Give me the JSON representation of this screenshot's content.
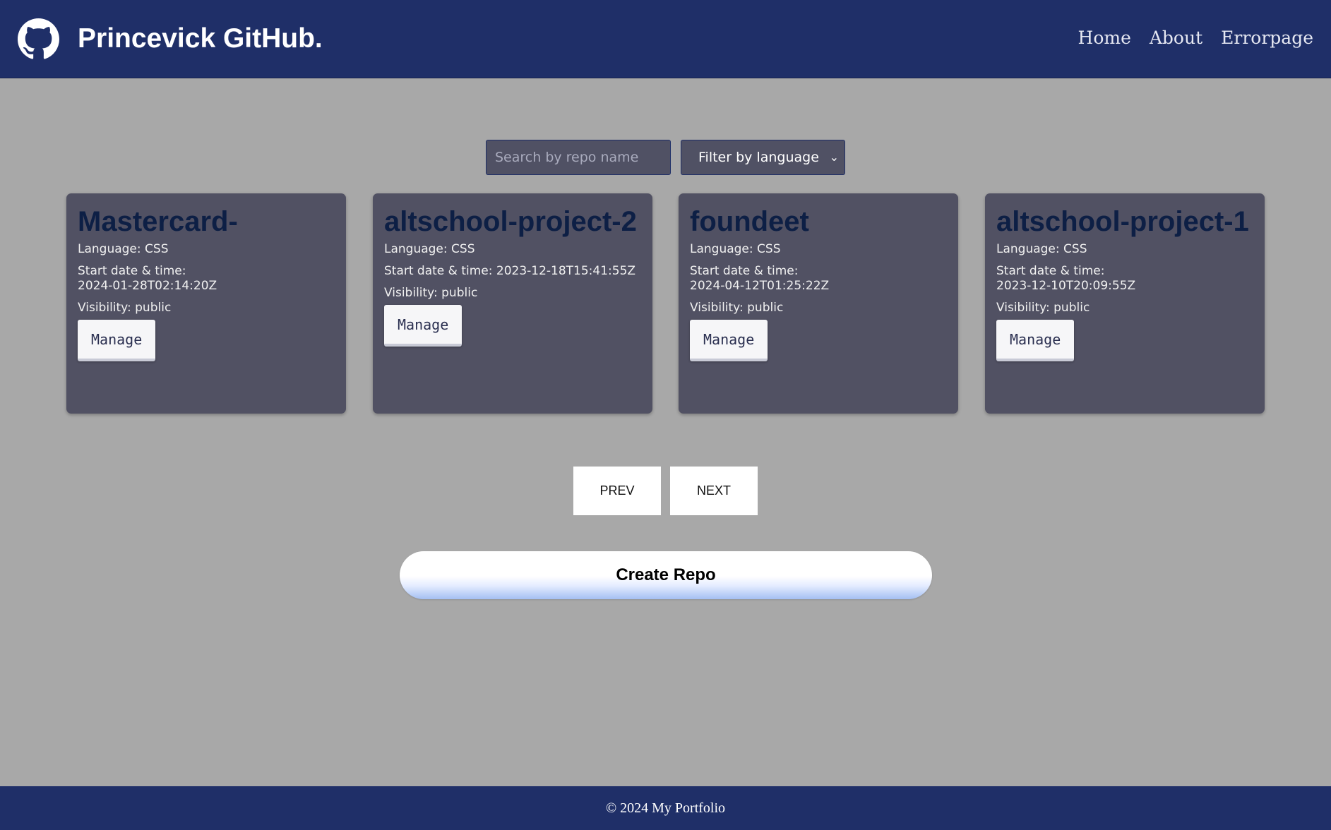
{
  "header": {
    "brand": "Princevick GitHub.",
    "logo_icon": "github-octocat-icon",
    "nav": [
      "Home",
      "About",
      "Errorpage"
    ]
  },
  "filters": {
    "search_placeholder": "Search by repo name",
    "language_selected": "Filter by language"
  },
  "labels": {
    "language": "Language: ",
    "start": "Start date & time: ",
    "visibility": "Visibility: ",
    "manage": "Manage"
  },
  "repos": [
    {
      "name": "Mastercard-",
      "language": "CSS",
      "start": "2024-01-28T02:14:20Z",
      "visibility": "public"
    },
    {
      "name": "altschool-project-2",
      "language": "CSS",
      "start": "2023-12-18T15:41:55Z",
      "visibility": "public"
    },
    {
      "name": "foundeet",
      "language": "CSS",
      "start": "2024-04-12T01:25:22Z",
      "visibility": "public"
    },
    {
      "name": "altschool-project-1",
      "language": "CSS",
      "start": "2023-12-10T20:09:55Z",
      "visibility": "public"
    }
  ],
  "pagination": {
    "prev": "PREV",
    "next": "NEXT"
  },
  "create_button": "Create Repo",
  "footer": "© 2024 My Portfolio",
  "colors": {
    "header_bg": "#1f2f68",
    "page_bg": "#a8a8a8",
    "card_bg": "#515163",
    "card_title": "#0d1f45"
  }
}
